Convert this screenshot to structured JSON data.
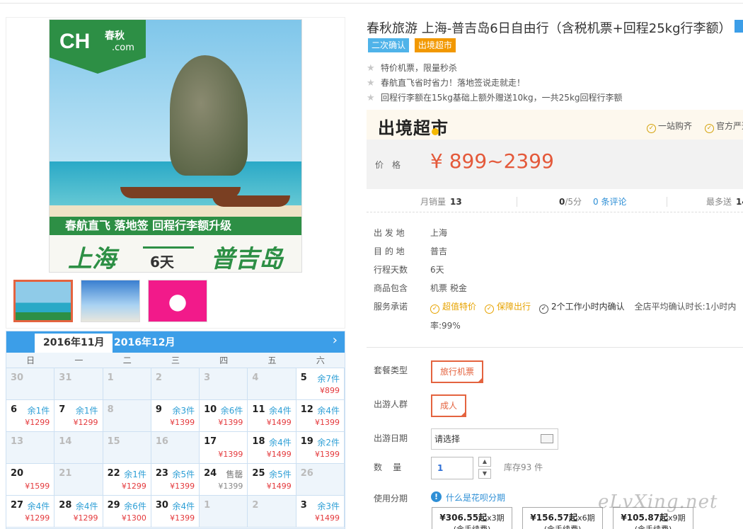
{
  "gallery": {
    "logo_text": "CH",
    "logo_sub": "春秋",
    "logo_com": ".com",
    "banner_line": "春航直飞  落地签  回程行李额升级",
    "city_from": "上海",
    "duration": "6天",
    "city_to": "普吉岛"
  },
  "calendar": {
    "months": [
      "2016年11月",
      "2016年12月"
    ],
    "next_icon": "chevron-right-icon",
    "weekdays": [
      "日",
      "一",
      "二",
      "三",
      "四",
      "五",
      "六"
    ],
    "weeks": [
      [
        {
          "d": "30",
          "s": "",
          "p": ""
        },
        {
          "d": "31",
          "s": "",
          "p": ""
        },
        {
          "d": "1",
          "s": "",
          "p": ""
        },
        {
          "d": "2",
          "s": "",
          "p": ""
        },
        {
          "d": "3",
          "s": "",
          "p": ""
        },
        {
          "d": "4",
          "s": "",
          "p": ""
        },
        {
          "d": "5",
          "s": "余7件",
          "p": "¥899"
        }
      ],
      [
        {
          "d": "6",
          "s": "余1件",
          "p": "¥1299"
        },
        {
          "d": "7",
          "s": "余1件",
          "p": "¥1299"
        },
        {
          "d": "8",
          "s": "",
          "p": ""
        },
        {
          "d": "9",
          "s": "余3件",
          "p": "¥1399"
        },
        {
          "d": "10",
          "s": "余6件",
          "p": "¥1399"
        },
        {
          "d": "11",
          "s": "余4件",
          "p": "¥1499"
        },
        {
          "d": "12",
          "s": "余4件",
          "p": "¥1399"
        }
      ],
      [
        {
          "d": "13",
          "s": "",
          "p": ""
        },
        {
          "d": "14",
          "s": "",
          "p": ""
        },
        {
          "d": "15",
          "s": "",
          "p": ""
        },
        {
          "d": "16",
          "s": "",
          "p": ""
        },
        {
          "d": "17",
          "s": "",
          "p": "¥1399"
        },
        {
          "d": "18",
          "s": "余4件",
          "p": "¥1499"
        },
        {
          "d": "19",
          "s": "余2件",
          "p": "¥1399"
        }
      ],
      [
        {
          "d": "20",
          "s": "",
          "p": "¥1599"
        },
        {
          "d": "21",
          "s": "",
          "p": ""
        },
        {
          "d": "22",
          "s": "余1件",
          "p": "¥1299"
        },
        {
          "d": "23",
          "s": "余5件",
          "p": "¥1399"
        },
        {
          "d": "24",
          "s": "售罄",
          "p": "¥1399"
        },
        {
          "d": "25",
          "s": "余5件",
          "p": "¥1499"
        },
        {
          "d": "26",
          "s": "",
          "p": ""
        }
      ],
      [
        {
          "d": "27",
          "s": "余4件",
          "p": "¥1299"
        },
        {
          "d": "28",
          "s": "余4件",
          "p": "¥1299"
        },
        {
          "d": "29",
          "s": "余6件",
          "p": "¥1300"
        },
        {
          "d": "30",
          "s": "余4件",
          "p": "¥1399"
        },
        {
          "d": "1",
          "s": "",
          "p": ""
        },
        {
          "d": "2",
          "s": "",
          "p": ""
        },
        {
          "d": "3",
          "s": "余3件",
          "p": "¥1499"
        }
      ]
    ]
  },
  "product": {
    "title": "春秋旅游 上海-普吉岛6日自由行（含税机票+回程25kg行李额）",
    "tags": [
      "二次确认",
      "出境超市"
    ],
    "features": [
      "特价机票，限量秒杀",
      "春航直飞省时省力！落地签说走就走！",
      "回程行李额在15kg基础上额外赠送10kg，一共25kg回程行李额"
    ]
  },
  "supermarket": {
    "logo": "出境超市",
    "checks": [
      "一站购齐",
      "官方严选"
    ]
  },
  "price": {
    "label": "价格",
    "value": "¥ 899~2399"
  },
  "stats": {
    "monthly_label": "月销量",
    "monthly_value": "13",
    "rating_value": "0",
    "rating_suffix": "/5分",
    "reviews_link": "0 条评论",
    "max_label": "最多送",
    "max_value": "14"
  },
  "details": [
    {
      "label": "出 发 地",
      "value": "上海"
    },
    {
      "label": "目 的 地",
      "value": "普吉"
    },
    {
      "label": "行程天数",
      "value": "6天"
    },
    {
      "label": "商品包含",
      "value": "机票  税金"
    }
  ],
  "service": {
    "label": "服务承诺",
    "items": [
      "超值特价",
      "保障出行",
      "2个工作小时内确认"
    ],
    "confirm_text": "全店平均确认时长:1小时内",
    "rate_text": "率:99%"
  },
  "options": {
    "package_label": "套餐类型",
    "package_value": "旅行机票",
    "people_label": "出游人群",
    "people_value": "成人",
    "date_label": "出游日期",
    "date_placeholder": "请选择",
    "qty_label": "数    量",
    "qty_value": "1",
    "stock_text": "库存93 件",
    "installment_label": "使用分期",
    "huabei_link": "什么是花呗分期",
    "installments": [
      {
        "amount": "¥306.55起",
        "periods": "x3期",
        "fee": "(含手续费)"
      },
      {
        "amount": "¥156.57起",
        "periods": "x6期",
        "fee": "(含手续费)"
      },
      {
        "amount": "¥105.87起",
        "periods": "x9期",
        "fee": "(含手续费)"
      }
    ]
  },
  "watermark": "eLvXing.net",
  "colors": {
    "accent": "#e4633f",
    "calendar_blue": "#3c9ee8",
    "price_red": "#e4593a"
  }
}
